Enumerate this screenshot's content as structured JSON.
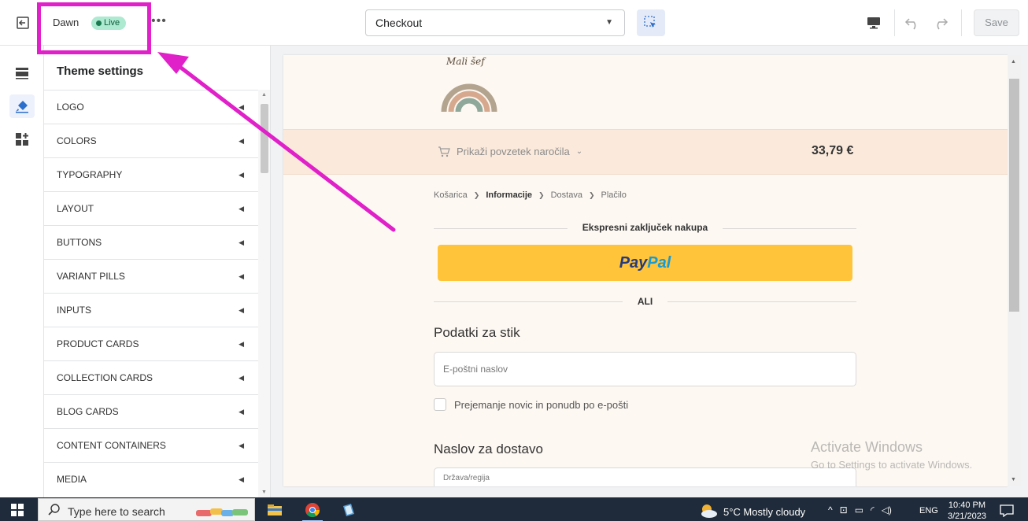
{
  "topbar": {
    "theme_name": "Dawn",
    "live_label": "Live",
    "more_label": "•••",
    "page_select": "Checkout",
    "save_label": "Save"
  },
  "sidebar": {
    "title": "Theme settings",
    "items": [
      {
        "label": "LOGO"
      },
      {
        "label": "COLORS"
      },
      {
        "label": "TYPOGRAPHY"
      },
      {
        "label": "LAYOUT"
      },
      {
        "label": "BUTTONS"
      },
      {
        "label": "VARIANT PILLS"
      },
      {
        "label": "INPUTS"
      },
      {
        "label": "PRODUCT CARDS"
      },
      {
        "label": "COLLECTION CARDS"
      },
      {
        "label": "BLOG CARDS"
      },
      {
        "label": "CONTENT CONTAINERS"
      },
      {
        "label": "MEDIA"
      }
    ]
  },
  "preview": {
    "logo_text": "Mali šef",
    "summary_link": "Prikaži povzetek naročila",
    "summary_total": "33,79 €",
    "breadcrumb": [
      "Košarica",
      "Informacije",
      "Dostava",
      "Plačilo"
    ],
    "express_label": "Ekspresni zaključek nakupa",
    "paypal_pay": "Pay",
    "paypal_pal": "Pal",
    "or_label": "ALI",
    "contact_title": "Podatki za stik",
    "email_placeholder": "E-poštni naslov",
    "newsletter_label": "Prejemanje novic in ponudb po e-pošti",
    "shipping_title": "Naslov za dostavo",
    "country_label": "Država/regija"
  },
  "watermark": {
    "line1": "Activate Windows",
    "line2": "Go to Settings to activate Windows."
  },
  "taskbar": {
    "search_placeholder": "Type here to search",
    "weather": "5°C  Mostly cloudy",
    "lang": "ENG",
    "time": "10:40 PM",
    "date": "3/21/2023"
  },
  "colors": {
    "annotation": "#e020c8",
    "live_badge": "#aee9d1",
    "paypal": "#ffc439",
    "summary_bar": "#fbeadc"
  }
}
